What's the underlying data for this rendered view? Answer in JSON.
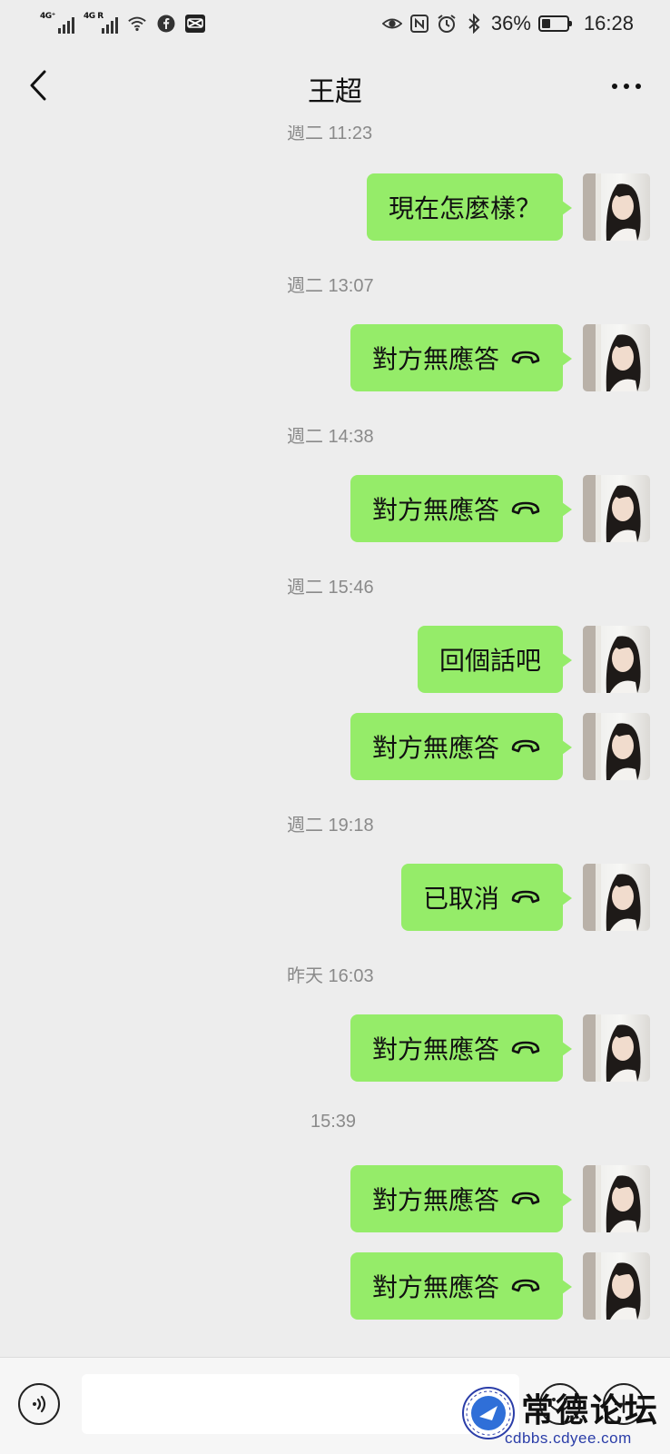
{
  "status_bar": {
    "signal_1": "4G⁺",
    "signal_2": "4G R",
    "battery_percent": "36%",
    "battery_level": 0.36,
    "time": "16:28",
    "icons": [
      "signal-icon",
      "signal-icon",
      "wifi-icon",
      "facebook-icon",
      "capcut-icon",
      "eye-icon",
      "nfc-icon",
      "alarm-icon",
      "bluetooth-icon",
      "battery-icon"
    ]
  },
  "header": {
    "title": "王超",
    "back_icon": "chevron-left-icon",
    "more_icon": "more-icon"
  },
  "messages": [
    {
      "type": "time",
      "text": "週二 11:23"
    },
    {
      "type": "text",
      "text": "現在怎麼樣？"
    },
    {
      "type": "time",
      "text": "週二 13:07"
    },
    {
      "type": "call",
      "text": "對方無應答"
    },
    {
      "type": "time",
      "text": "週二 14:38"
    },
    {
      "type": "call",
      "text": "對方無應答"
    },
    {
      "type": "time",
      "text": "週二 15:46"
    },
    {
      "type": "text",
      "text": "回個話吧"
    },
    {
      "type": "call",
      "text": "對方無應答"
    },
    {
      "type": "time",
      "text": "週二 19:18"
    },
    {
      "type": "call",
      "text": "已取消"
    },
    {
      "type": "time",
      "text": "昨天 16:03"
    },
    {
      "type": "call",
      "text": "對方無應答"
    },
    {
      "type": "time",
      "text": "15:39"
    },
    {
      "type": "call",
      "text": "對方無應答"
    },
    {
      "type": "call",
      "text": "對方無應答"
    }
  ],
  "input_bar": {
    "voice_icon": "voice-icon",
    "emoji_icon": "emoji-icon",
    "plus_icon": "plus-icon"
  },
  "watermark": {
    "name": "常德论坛",
    "url": "cdbbs.cdyee.com"
  },
  "colors": {
    "background": "#ededed",
    "bubble": "#95ec69",
    "timestamp": "#8a8a8a",
    "watermark_url": "#2a3da8"
  }
}
